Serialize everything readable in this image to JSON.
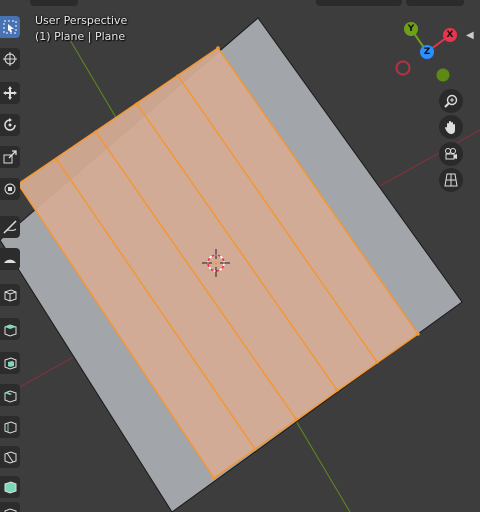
{
  "viewport": {
    "perspective_label": "User Perspective",
    "object_label": "(1) Plane | Plane"
  },
  "gizmo": {
    "axes": [
      {
        "name": "Y",
        "color": "#6e9f18"
      },
      {
        "name": "X",
        "color": "#e8344c"
      },
      {
        "name": "Z",
        "color": "#2c8fff"
      }
    ],
    "negative_colors": {
      "x": "#b43243",
      "y": "#5c8a14"
    }
  },
  "toolbar": {
    "items": [
      {
        "name": "select-box-icon",
        "active": true
      },
      {
        "name": "cursor-icon",
        "active": false
      },
      {
        "name": "move-icon",
        "active": false
      },
      {
        "name": "rotate-icon",
        "active": false
      },
      {
        "name": "scale-icon",
        "active": false
      },
      {
        "name": "transform-icon",
        "active": false
      },
      {
        "name": "annotate-icon",
        "active": false
      },
      {
        "name": "measure-icon",
        "active": false
      },
      {
        "name": "add-cube-icon",
        "active": false
      },
      {
        "name": "extrude-icon",
        "active": false
      },
      {
        "name": "inset-icon",
        "active": false
      },
      {
        "name": "bevel-icon",
        "active": false
      },
      {
        "name": "loop-cut-icon",
        "active": false
      },
      {
        "name": "knife-icon",
        "active": false
      },
      {
        "name": "poly-build-icon",
        "active": false
      },
      {
        "name": "spin-icon",
        "active": false
      }
    ]
  },
  "nav_buttons": [
    {
      "name": "zoom-icon"
    },
    {
      "name": "pan-hand-icon"
    },
    {
      "name": "camera-view-icon"
    },
    {
      "name": "ortho-grid-icon"
    }
  ],
  "colors": {
    "background": "#3d3d3d",
    "plane_gray": "#a2a5a9",
    "selected_face": "#d4ab94",
    "selected_edge": "#f6962e",
    "axis_x_line": "#8b2f3b",
    "axis_y_line": "#5e8b1d",
    "active_tool": "#4772b3"
  }
}
